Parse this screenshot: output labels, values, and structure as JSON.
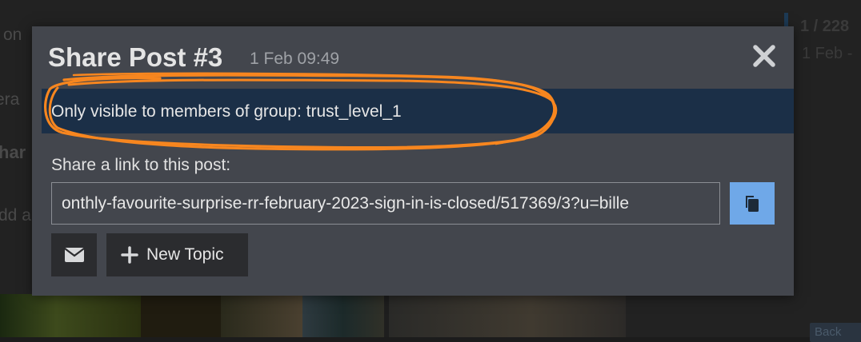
{
  "background": {
    "left_snippets": [
      "on",
      "era",
      "har",
      "dd a"
    ],
    "timeline": {
      "count": "1 / 228",
      "date": "1 Feb -"
    },
    "back_button": "Back"
  },
  "modal": {
    "title": "Share Post #3",
    "date": "1 Feb 09:49",
    "close_icon": "close-icon",
    "notice": "Only visible to members of group: trust_level_1",
    "share_label": "Share a link to this post:",
    "share_url": "onthly-favourite-surprise-rr-february-2023-sign-in-is-closed/517369/3?u=bille",
    "copy_icon": "copy-icon",
    "email_icon": "envelope-icon",
    "new_topic_label": "New Topic",
    "new_topic_icon": "plus-icon"
  },
  "colors": {
    "modal_bg": "#43464d",
    "notice_bg": "#1b2f47",
    "copy_button_bg": "#6fa8e8",
    "secondary_button_bg": "#2b2c2f",
    "annotation_stroke": "#f7861f"
  }
}
